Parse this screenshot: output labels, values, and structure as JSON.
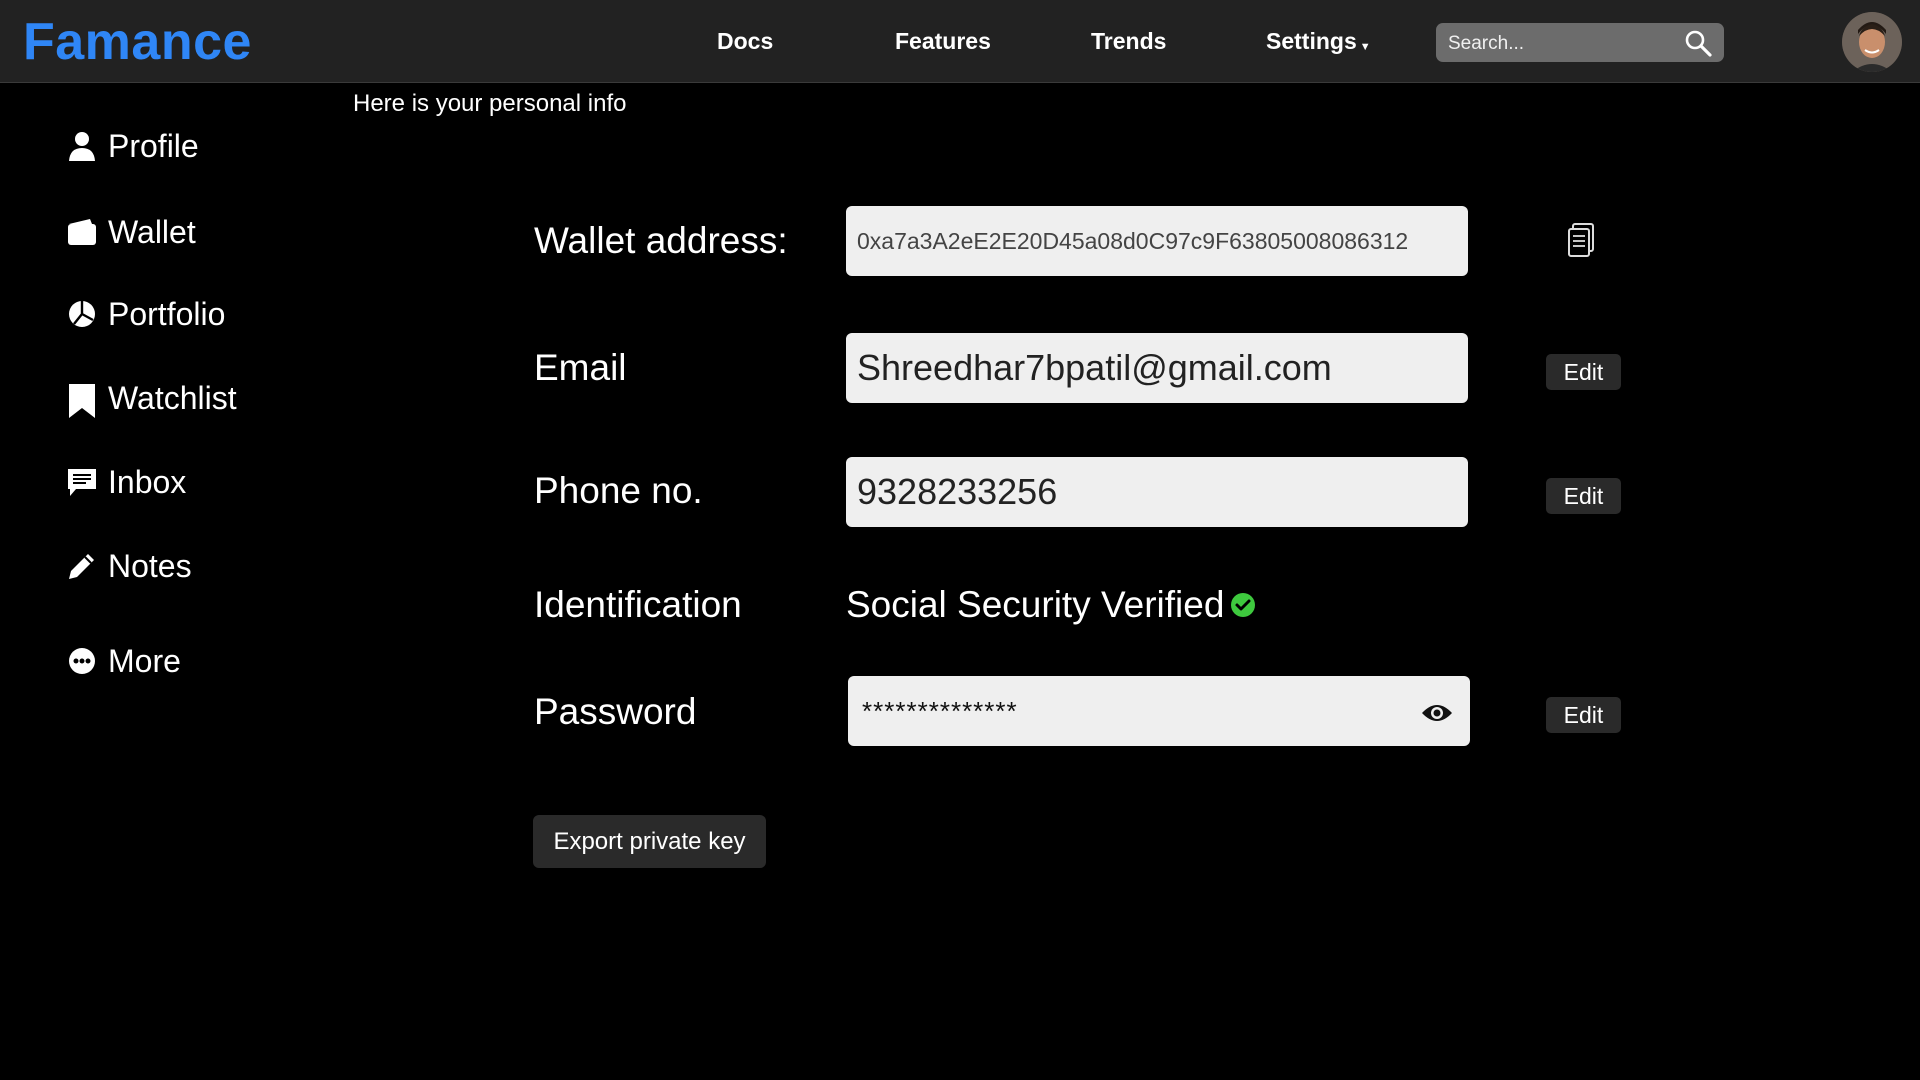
{
  "header": {
    "brand": "Famance",
    "nav": {
      "docs": "Docs",
      "features": "Features",
      "trends": "Trends",
      "settings": "Settings"
    },
    "search_placeholder": "Search..."
  },
  "sidebar": {
    "items": [
      {
        "label": "Profile",
        "icon": "person-icon"
      },
      {
        "label": "Wallet",
        "icon": "wallet-icon"
      },
      {
        "label": "Portfolio",
        "icon": "pie-chart-icon"
      },
      {
        "label": "Watchlist",
        "icon": "bookmark-icon"
      },
      {
        "label": "Inbox",
        "icon": "message-icon"
      },
      {
        "label": "Notes",
        "icon": "pencil-icon"
      },
      {
        "label": "More",
        "icon": "more-dots-icon"
      }
    ]
  },
  "main": {
    "intro": "Here is your personal info",
    "wallet": {
      "label": "Wallet address:",
      "value": "0xa7a3A2eE2E20D45a08d0C97c9F63805008086312"
    },
    "email": {
      "label": "Email",
      "value": "Shreedhar7bpatil@gmail.com",
      "edit": "Edit"
    },
    "phone": {
      "label": "Phone no.",
      "value": "9328233256",
      "edit": "Edit"
    },
    "identification": {
      "label": "Identification",
      "value": "Social Security Verified"
    },
    "password": {
      "label": "Password",
      "value": "**************",
      "edit": "Edit"
    },
    "export_button": "Export private key"
  },
  "colors": {
    "brand": "#2f86f6",
    "topbar": "#222222",
    "verified": "#3ec93e",
    "field_bg": "#efefef"
  }
}
